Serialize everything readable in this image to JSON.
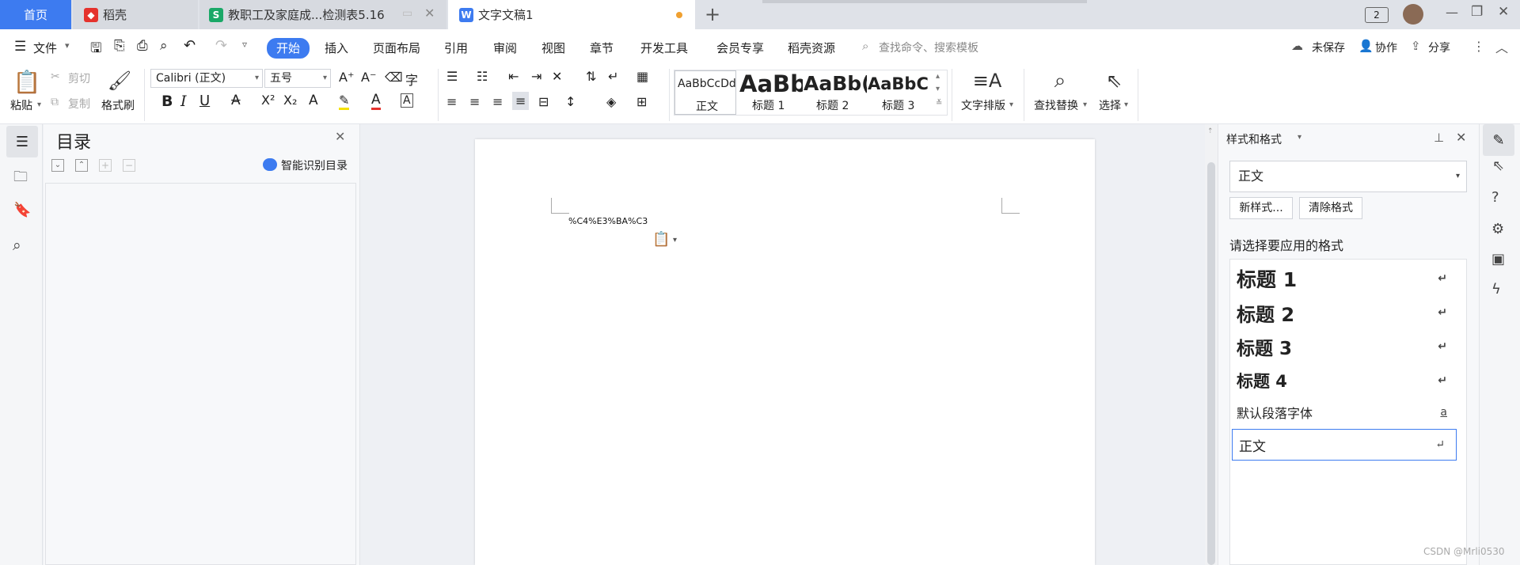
{
  "tabs": {
    "home": "首页",
    "daoke": "稻壳",
    "sheet": "教职工及家庭成...检测表5.16",
    "doc": "文字文稿1",
    "user_badge": "2"
  },
  "menu": {
    "file": "文件",
    "items": [
      "开始",
      "插入",
      "页面布局",
      "引用",
      "审阅",
      "视图",
      "章节",
      "开发工具",
      "会员专享",
      "稻壳资源"
    ],
    "search_placeholder": "查找命令、搜索模板",
    "unsaved": "未保存",
    "collab": "协作",
    "share": "分享"
  },
  "ribbon": {
    "paste": "粘贴",
    "cut": "剪切",
    "copy": "复制",
    "format_painter": "格式刷",
    "font_name": "Calibri (正文)",
    "font_size": "五号",
    "styles": [
      {
        "preview": "AaBbCcDd",
        "label": "正文"
      },
      {
        "preview": "AaBb",
        "label": "标题 1"
      },
      {
        "preview": "AaBb(",
        "label": "标题 2"
      },
      {
        "preview": "AaBbC",
        "label": "标题 3"
      }
    ],
    "text_layout": "文字排版",
    "find_replace": "查找替换",
    "select": "选择"
  },
  "toc": {
    "title": "目录",
    "smart": "智能识别目录"
  },
  "document": {
    "text": "%C4%E3%BA%C3"
  },
  "panel": {
    "title": "样式和格式",
    "current_style": "正文",
    "new_style": "新样式...",
    "clear_format": "清除格式",
    "prompt": "请选择要应用的格式",
    "styles": [
      {
        "label": "标题 1",
        "mark": "↵"
      },
      {
        "label": "标题 2",
        "mark": "↵"
      },
      {
        "label": "标题 3",
        "mark": "↵"
      },
      {
        "label": "标题 4",
        "mark": "↵"
      },
      {
        "label": "默认段落字体",
        "mark": "a"
      },
      {
        "label": "正文",
        "mark": "↵"
      }
    ]
  },
  "watermark": "CSDN @Mrli0530",
  "colors": {
    "accent": "#3d7bf0",
    "daoke_red": "#e5322d",
    "sheet_green": "#1aa867"
  }
}
